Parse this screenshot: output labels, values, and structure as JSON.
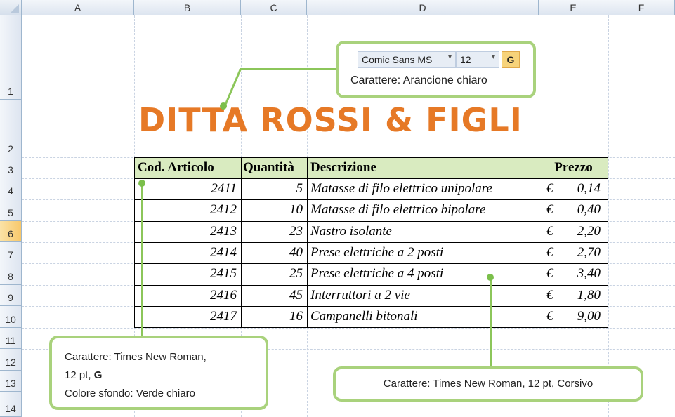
{
  "columns": [
    "A",
    "B",
    "C",
    "D",
    "E",
    "F"
  ],
  "rows": [
    "1",
    "2",
    "3",
    "4",
    "5",
    "6",
    "7",
    "8",
    "9",
    "10",
    "11",
    "12",
    "13",
    "14"
  ],
  "selected_row": "6",
  "title": "DITTA ROSSI & FIGLI",
  "table": {
    "headers": [
      "Cod. Articolo",
      "Quantità",
      "Descrizione",
      "Prezzo"
    ],
    "rows": [
      {
        "code": "2411",
        "qty": "5",
        "desc": "Matasse di filo elettrico unipolare",
        "cur": "€",
        "price": "0,14"
      },
      {
        "code": "2412",
        "qty": "10",
        "desc": "Matasse di filo elettrico bipolare",
        "cur": "€",
        "price": "0,40"
      },
      {
        "code": "2413",
        "qty": "23",
        "desc": "Nastro isolante",
        "cur": "€",
        "price": "2,20"
      },
      {
        "code": "2414",
        "qty": "40",
        "desc": "Prese elettriche a 2 posti",
        "cur": "€",
        "price": "2,70"
      },
      {
        "code": "2415",
        "qty": "25",
        "desc": "Prese elettriche a 4 posti",
        "cur": "€",
        "price": "3,40"
      },
      {
        "code": "2416",
        "qty": "45",
        "desc": "Interruttori a 2 vie",
        "cur": "€",
        "price": "1,80"
      },
      {
        "code": "2417",
        "qty": "16",
        "desc": "Campanelli bitonali",
        "cur": "€",
        "price": "9,00"
      }
    ]
  },
  "callout_top": {
    "font_name": "Comic Sans MS",
    "font_size": "12",
    "bold_label": "G",
    "text": "Carattere: Arancione chiaro"
  },
  "callout_left": {
    "line1": "Carattere: Times New  Roman,",
    "line2a": "12 pt, ",
    "line2b": "G",
    "line3": "Colore sfondo: Verde chiaro"
  },
  "callout_right": {
    "text": "Carattere: Times New Roman, 12 pt, Corsivo"
  },
  "colors": {
    "title": "#e67926",
    "header_bg": "#d9ebc0",
    "callout_border": "#a9d27c",
    "selected_row": "#f7c86b"
  },
  "icons": {
    "dropdown": "chevron-down-icon"
  }
}
